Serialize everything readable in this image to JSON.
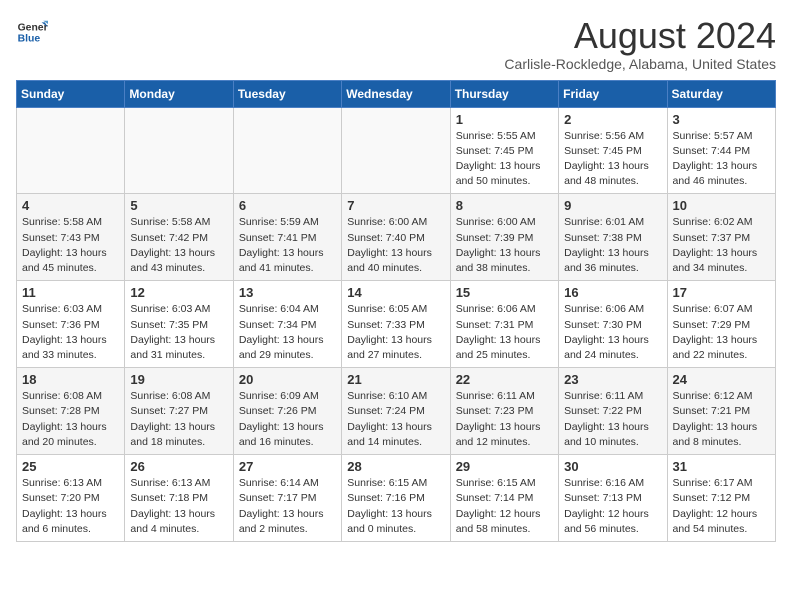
{
  "header": {
    "logo_line1": "General",
    "logo_line2": "Blue",
    "month_year": "August 2024",
    "location": "Carlisle-Rockledge, Alabama, United States"
  },
  "weekdays": [
    "Sunday",
    "Monday",
    "Tuesday",
    "Wednesday",
    "Thursday",
    "Friday",
    "Saturday"
  ],
  "weeks": [
    [
      {
        "day": "",
        "detail": ""
      },
      {
        "day": "",
        "detail": ""
      },
      {
        "day": "",
        "detail": ""
      },
      {
        "day": "",
        "detail": ""
      },
      {
        "day": "1",
        "detail": "Sunrise: 5:55 AM\nSunset: 7:45 PM\nDaylight: 13 hours\nand 50 minutes."
      },
      {
        "day": "2",
        "detail": "Sunrise: 5:56 AM\nSunset: 7:45 PM\nDaylight: 13 hours\nand 48 minutes."
      },
      {
        "day": "3",
        "detail": "Sunrise: 5:57 AM\nSunset: 7:44 PM\nDaylight: 13 hours\nand 46 minutes."
      }
    ],
    [
      {
        "day": "4",
        "detail": "Sunrise: 5:58 AM\nSunset: 7:43 PM\nDaylight: 13 hours\nand 45 minutes."
      },
      {
        "day": "5",
        "detail": "Sunrise: 5:58 AM\nSunset: 7:42 PM\nDaylight: 13 hours\nand 43 minutes."
      },
      {
        "day": "6",
        "detail": "Sunrise: 5:59 AM\nSunset: 7:41 PM\nDaylight: 13 hours\nand 41 minutes."
      },
      {
        "day": "7",
        "detail": "Sunrise: 6:00 AM\nSunset: 7:40 PM\nDaylight: 13 hours\nand 40 minutes."
      },
      {
        "day": "8",
        "detail": "Sunrise: 6:00 AM\nSunset: 7:39 PM\nDaylight: 13 hours\nand 38 minutes."
      },
      {
        "day": "9",
        "detail": "Sunrise: 6:01 AM\nSunset: 7:38 PM\nDaylight: 13 hours\nand 36 minutes."
      },
      {
        "day": "10",
        "detail": "Sunrise: 6:02 AM\nSunset: 7:37 PM\nDaylight: 13 hours\nand 34 minutes."
      }
    ],
    [
      {
        "day": "11",
        "detail": "Sunrise: 6:03 AM\nSunset: 7:36 PM\nDaylight: 13 hours\nand 33 minutes."
      },
      {
        "day": "12",
        "detail": "Sunrise: 6:03 AM\nSunset: 7:35 PM\nDaylight: 13 hours\nand 31 minutes."
      },
      {
        "day": "13",
        "detail": "Sunrise: 6:04 AM\nSunset: 7:34 PM\nDaylight: 13 hours\nand 29 minutes."
      },
      {
        "day": "14",
        "detail": "Sunrise: 6:05 AM\nSunset: 7:33 PM\nDaylight: 13 hours\nand 27 minutes."
      },
      {
        "day": "15",
        "detail": "Sunrise: 6:06 AM\nSunset: 7:31 PM\nDaylight: 13 hours\nand 25 minutes."
      },
      {
        "day": "16",
        "detail": "Sunrise: 6:06 AM\nSunset: 7:30 PM\nDaylight: 13 hours\nand 24 minutes."
      },
      {
        "day": "17",
        "detail": "Sunrise: 6:07 AM\nSunset: 7:29 PM\nDaylight: 13 hours\nand 22 minutes."
      }
    ],
    [
      {
        "day": "18",
        "detail": "Sunrise: 6:08 AM\nSunset: 7:28 PM\nDaylight: 13 hours\nand 20 minutes."
      },
      {
        "day": "19",
        "detail": "Sunrise: 6:08 AM\nSunset: 7:27 PM\nDaylight: 13 hours\nand 18 minutes."
      },
      {
        "day": "20",
        "detail": "Sunrise: 6:09 AM\nSunset: 7:26 PM\nDaylight: 13 hours\nand 16 minutes."
      },
      {
        "day": "21",
        "detail": "Sunrise: 6:10 AM\nSunset: 7:24 PM\nDaylight: 13 hours\nand 14 minutes."
      },
      {
        "day": "22",
        "detail": "Sunrise: 6:11 AM\nSunset: 7:23 PM\nDaylight: 13 hours\nand 12 minutes."
      },
      {
        "day": "23",
        "detail": "Sunrise: 6:11 AM\nSunset: 7:22 PM\nDaylight: 13 hours\nand 10 minutes."
      },
      {
        "day": "24",
        "detail": "Sunrise: 6:12 AM\nSunset: 7:21 PM\nDaylight: 13 hours\nand 8 minutes."
      }
    ],
    [
      {
        "day": "25",
        "detail": "Sunrise: 6:13 AM\nSunset: 7:20 PM\nDaylight: 13 hours\nand 6 minutes."
      },
      {
        "day": "26",
        "detail": "Sunrise: 6:13 AM\nSunset: 7:18 PM\nDaylight: 13 hours\nand 4 minutes."
      },
      {
        "day": "27",
        "detail": "Sunrise: 6:14 AM\nSunset: 7:17 PM\nDaylight: 13 hours\nand 2 minutes."
      },
      {
        "day": "28",
        "detail": "Sunrise: 6:15 AM\nSunset: 7:16 PM\nDaylight: 13 hours\nand 0 minutes."
      },
      {
        "day": "29",
        "detail": "Sunrise: 6:15 AM\nSunset: 7:14 PM\nDaylight: 12 hours\nand 58 minutes."
      },
      {
        "day": "30",
        "detail": "Sunrise: 6:16 AM\nSunset: 7:13 PM\nDaylight: 12 hours\nand 56 minutes."
      },
      {
        "day": "31",
        "detail": "Sunrise: 6:17 AM\nSunset: 7:12 PM\nDaylight: 12 hours\nand 54 minutes."
      }
    ]
  ]
}
